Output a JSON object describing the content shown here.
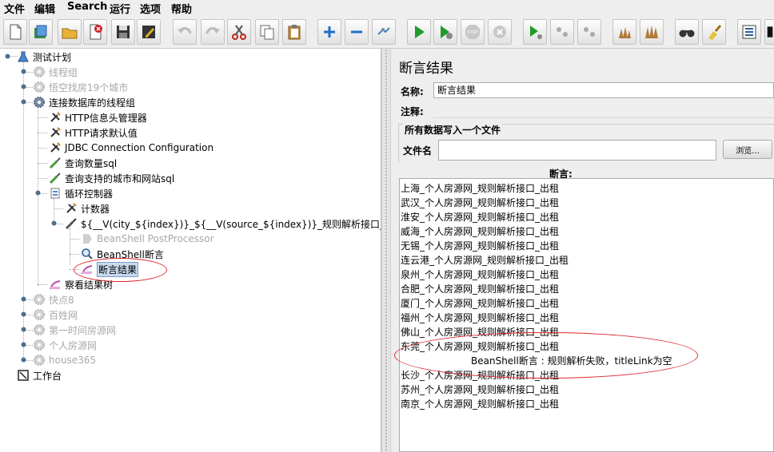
{
  "menubar": {
    "items": [
      "文件",
      "编辑",
      "Search",
      "运行",
      "选项",
      "帮助"
    ]
  },
  "toolbar": {
    "buttons": [
      "new-icon",
      "templates-icon",
      "open-icon",
      "close-icon",
      "save-icon",
      "save-as-icon",
      "undo-icon",
      "redo-icon",
      "cut-icon",
      "copy-icon",
      "paste-icon",
      "expand-icon",
      "collapse-icon",
      "toggle-icon",
      "start-icon",
      "start-no-pause-icon",
      "stop-icon",
      "shutdown-icon",
      "remote-start-icon",
      "remote-stop-icon",
      "remote-shutdown-icon",
      "clear-icon",
      "clear-all-icon",
      "search-icon",
      "reset-search-icon",
      "function-helper-icon",
      "help-icon"
    ]
  },
  "tree": {
    "root": "测试计划",
    "nodes": [
      {
        "label": "线程组",
        "disabled": true
      },
      {
        "label": "悟空找房19个城市",
        "disabled": true
      },
      {
        "label": "连接数据库的线程组",
        "disabled": false
      },
      {
        "label": "HTTP信息头管理器",
        "disabled": false
      },
      {
        "label": "HTTP请求默认值",
        "disabled": false
      },
      {
        "label": "JDBC Connection Configuration",
        "disabled": false
      },
      {
        "label": "查询数量sql",
        "disabled": false
      },
      {
        "label": "查询支持的城市和网站sql",
        "disabled": false
      },
      {
        "label": "循环控制器",
        "disabled": false
      },
      {
        "label": "计数器",
        "disabled": false
      },
      {
        "label": "${__V(city_${index})}_${__V(source_${index})}_规则解析接口_出租",
        "disabled": false
      },
      {
        "label": "BeanShell PostProcessor",
        "disabled": true
      },
      {
        "label": "BeanShell断言",
        "disabled": false
      },
      {
        "label": "断言结果",
        "disabled": false,
        "selected": true
      },
      {
        "label": "察看结果树",
        "disabled": false
      },
      {
        "label": "快点8",
        "disabled": true
      },
      {
        "label": "百姓网",
        "disabled": true
      },
      {
        "label": "第一时间房源网",
        "disabled": true
      },
      {
        "label": "个人房源网",
        "disabled": true
      },
      {
        "label": "house365",
        "disabled": true
      }
    ],
    "workbench": "工作台"
  },
  "panel": {
    "title": "断言结果",
    "name_label": "名称:",
    "name_value": "断言结果",
    "comment_label": "注释:",
    "comment_value": "",
    "file_group_title": "所有数据写入一个文件",
    "filename_label": "文件名",
    "filename_value": "",
    "browse_label": "浏览...",
    "assertions_header": "断言:",
    "results": [
      "上海_个人房源网_规则解析接口_出租",
      "武汉_个人房源网_规则解析接口_出租",
      "淮安_个人房源网_规则解析接口_出租",
      "威海_个人房源网_规则解析接口_出租",
      "无锡_个人房源网_规则解析接口_出租",
      "连云港_个人房源网_规则解析接口_出租",
      "泉州_个人房源网_规则解析接口_出租",
      "合肥_个人房源网_规则解析接口_出租",
      "厦门_个人房源网_规则解析接口_出租",
      "福州_个人房源网_规则解析接口_出租",
      "佛山_个人房源网_规则解析接口_出租",
      "东莞_个人房源网_规则解析接口_出租"
    ],
    "failure_message": "BeanShell断言 : 规则解析失败，titleLink为空",
    "results_after": [
      "长沙_个人房源网_规则解析接口_出租",
      "苏州_个人房源网_规则解析接口_出租",
      "南京_个人房源网_规则解析接口_出租"
    ]
  },
  "colors": {
    "selection": "#c9d9ef",
    "annotation": "#e0282e",
    "disabled_text": "#a8a8a8"
  }
}
